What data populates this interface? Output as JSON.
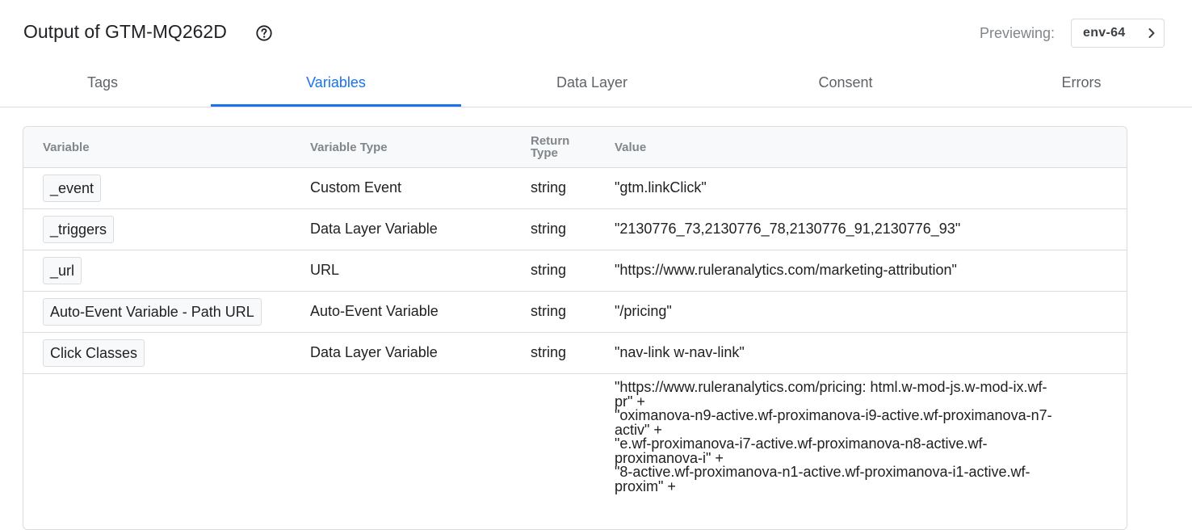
{
  "header": {
    "title": "Output of GTM-MQ262D",
    "previewing_label": "Previewing:",
    "env_label": "env-64"
  },
  "tabs": [
    {
      "label": "Tags",
      "active": false
    },
    {
      "label": "Variables",
      "active": true
    },
    {
      "label": "Data Layer",
      "active": false
    },
    {
      "label": "Consent",
      "active": false
    },
    {
      "label": "Errors",
      "active": false
    }
  ],
  "table": {
    "headers": {
      "variable": "Variable",
      "variable_type": "Variable Type",
      "return_type_line1": "Return",
      "return_type_line2": "Type",
      "value": "Value"
    },
    "rows": [
      {
        "variable": "_event",
        "type": "Custom Event",
        "return_type": "string",
        "value": "\"gtm.linkClick\""
      },
      {
        "variable": "_triggers",
        "type": "Data Layer Variable",
        "return_type": "string",
        "value": "\"2130776_73,2130776_78,2130776_91,2130776_93\""
      },
      {
        "variable": "_url",
        "type": "URL",
        "return_type": "string",
        "value": "\"https://www.ruleranalytics.com/marketing-attribution\""
      },
      {
        "variable": "Auto-Event Variable - Path URL",
        "type": "Auto-Event Variable",
        "return_type": "string",
        "value": "\"/pricing\""
      },
      {
        "variable": "Click Classes",
        "type": "Data Layer Variable",
        "return_type": "string",
        "value": "\"nav-link w-nav-link\""
      }
    ],
    "partial_row": {
      "value_lines": [
        "\"https://www.ruleranalytics.com/pricing: html.w-mod-js.w-mod-ix.wf-",
        "pr\" +",
        "\"oximanova-n9-active.wf-proximanova-i9-active.wf-proximanova-n7-",
        "activ\" +",
        "\"e.wf-proximanova-i7-active.wf-proximanova-n8-active.wf-",
        "proximanova-i\" +",
        "\"8-active.wf-proximanova-n1-active.wf-proximanova-i1-active.wf-",
        "proxim\" +"
      ]
    }
  },
  "icons": {
    "help": "help-circle-icon",
    "env_chevron": "chevron-right-icon"
  },
  "colors": {
    "accent": "#1a73e8",
    "border": "#dadce0",
    "header_bg": "#f8f9fa",
    "muted_text": "#80868b"
  }
}
